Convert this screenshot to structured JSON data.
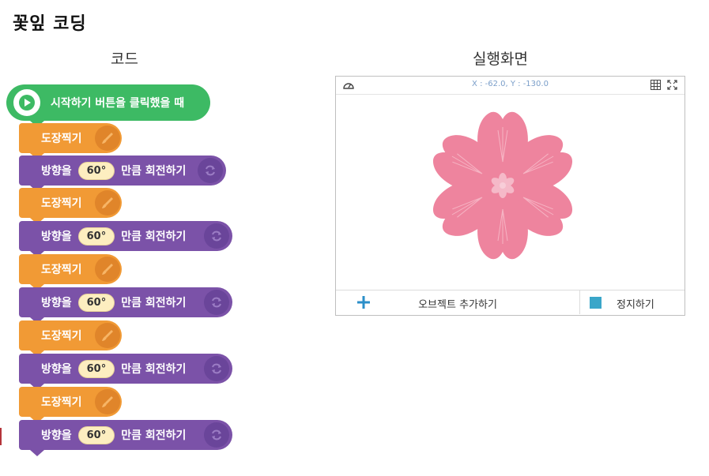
{
  "page_title": "꽃잎 코딩",
  "code_heading": "코드",
  "run_heading": "실행화면",
  "blocks": {
    "start_label": "시작하기 버튼을 클릭했을 때",
    "stamp_label": "도장찍기",
    "rotate_prefix": "방향을",
    "rotate_angle": "60°",
    "rotate_suffix": "만큼 회전하기"
  },
  "stage": {
    "coords": "X : -62.0, Y : -130.0",
    "add_object_label": "오브젝트 추가하기",
    "stop_label": "정지하기"
  },
  "colors": {
    "start": "#3dba64",
    "stamp": "#f19a35",
    "rotate": "#7b52a8",
    "petal": "#ee849e",
    "center": "#f5b9c8",
    "stop": "#3aa6c9"
  },
  "icons": [
    "play-icon",
    "brush-icon",
    "rotate-icon",
    "gauge-icon",
    "grid-icon",
    "expand-icon",
    "plus-icon",
    "stop-icon"
  ]
}
